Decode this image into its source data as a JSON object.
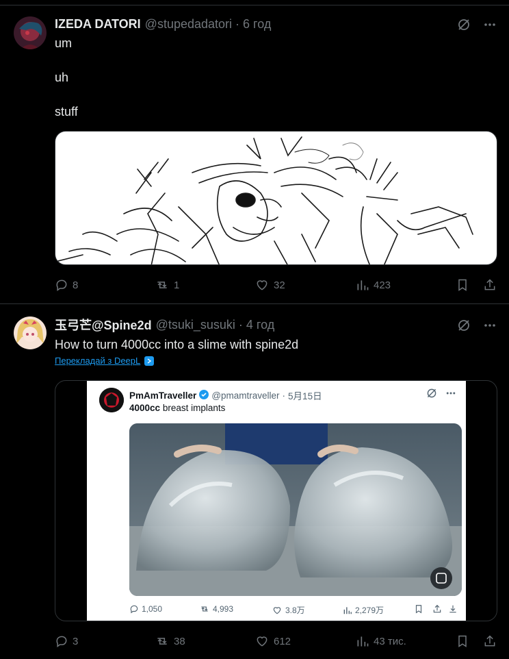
{
  "posts": [
    {
      "author_name": "IZEDA DATORI",
      "handle": "@stupedadatori",
      "separator": "·",
      "time": "6 год",
      "lines": [
        "um",
        "uh",
        "stuff"
      ],
      "stats": {
        "replies": "8",
        "reposts": "1",
        "likes": "32",
        "views": "423"
      }
    },
    {
      "author_name": "玉弓芒@Spine2d",
      "handle": "@tsuki_susuki",
      "separator": "·",
      "time": "4 год",
      "text": "How to turn 4000cc into a slime with spine2d",
      "translate_label": "Перекладай з DeepL",
      "stats": {
        "replies": "3",
        "reposts": "38",
        "likes": "612",
        "views": "43 тис."
      },
      "embedded": {
        "author_name": "PmAmTraveller",
        "handle": "@pmamtraveller",
        "separator": "·",
        "date": "5月15日",
        "text_bold": "4000cc",
        "text_rest": " breast implants",
        "stats": {
          "replies": "1,050",
          "reposts": "4,993",
          "likes": "3.8万",
          "views": "2,279万"
        }
      }
    }
  ],
  "icons": {
    "grok": "grok-slash-icon",
    "more": "more-dots-icon",
    "reply": "reply-bubble-icon",
    "repost": "repost-arrows-icon",
    "like": "heart-icon",
    "views": "bar-chart-icon",
    "bookmark": "bookmark-icon",
    "share": "share-upload-icon",
    "verified": "verified-badge-icon"
  },
  "colors": {
    "background": "#000000",
    "text": "#e7e9ea",
    "muted": "#71767b",
    "accent": "#1d9bf0",
    "divider": "#2f3336"
  }
}
